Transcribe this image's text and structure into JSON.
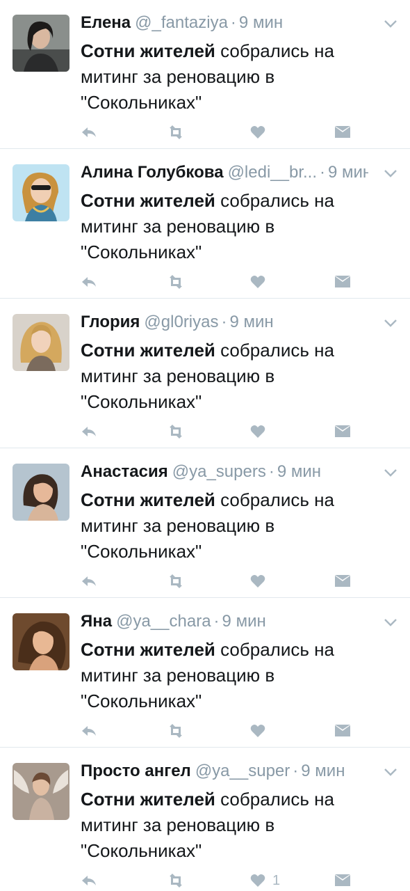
{
  "colors": {
    "text": "#14171a",
    "muted": "#8899a6",
    "icon": "#aab8c2",
    "divider": "#e1e8ed"
  },
  "icons": {
    "reply": "reply-icon",
    "retweet": "retweet-icon",
    "like": "heart-icon",
    "dm": "envelope-icon",
    "menu": "chevron-down-icon"
  },
  "tweets": [
    {
      "name": "Елена",
      "handle": "@_fantaziya",
      "dot": "·",
      "time": "9 мин",
      "bold": "Сотни жителей",
      "text": " собрались на митинг за реновацию в \"Сокольниках\"",
      "likes": ""
    },
    {
      "name": "Алина Голубкова",
      "handle": "@ledi__br...",
      "dot": "·",
      "time": "9 мин",
      "bold": "Сотни жителей",
      "text": " собрались на митинг за реновацию в \"Сокольниках\"",
      "likes": ""
    },
    {
      "name": "Глория",
      "handle": "@gl0riyas",
      "dot": "·",
      "time": "9 мин",
      "bold": "Сотни жителей",
      "text": " собрались на митинг за реновацию в \"Сокольниках\"",
      "likes": ""
    },
    {
      "name": "Анастасия",
      "handle": "@ya_supers",
      "dot": "·",
      "time": "9 мин",
      "bold": "Сотни жителей",
      "text": " собрались на митинг за реновацию в \"Сокольниках\"",
      "likes": ""
    },
    {
      "name": "Яна",
      "handle": "@ya__chara",
      "dot": "·",
      "time": "9 мин",
      "bold": "Сотни жителей",
      "text": " собрались на митинг за реновацию в \"Сокольниках\"",
      "likes": ""
    },
    {
      "name": "Просто ангел",
      "handle": "@ya__super",
      "dot": "·",
      "time": "9 мин",
      "bold": "Сотни жителей",
      "text": " собрались на митинг за реновацию в \"Сокольниках\"",
      "likes": "1"
    }
  ]
}
